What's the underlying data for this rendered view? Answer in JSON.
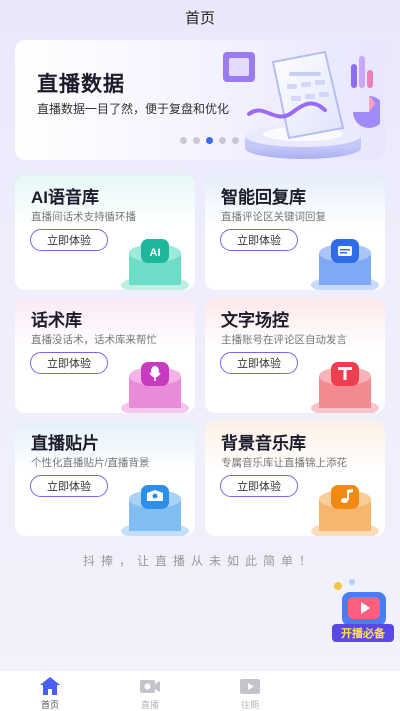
{
  "header": {
    "title": "首页"
  },
  "banner": {
    "title": "直播数据",
    "description": "直播数据一目了然，便于复盘和优化",
    "dots": 5,
    "active_dot": 2
  },
  "cards": [
    {
      "title": "AI语音库",
      "desc": "直播间话术支持循环播",
      "button": "立即体验",
      "icon": "ai-icon",
      "icon_text": "AI"
    },
    {
      "title": "智能回复库",
      "desc": "直播评论区关键词回复",
      "button": "立即体验",
      "icon": "reply-icon"
    },
    {
      "title": "话术库",
      "desc": "直播没话术，话术库来帮忙",
      "button": "立即体验",
      "icon": "microphone-icon"
    },
    {
      "title": "文字场控",
      "desc": "主播账号在评论区自动发言",
      "button": "立即体验",
      "icon": "text-t-icon"
    },
    {
      "title": "直播贴片",
      "desc": "个性化直播贴片/直播背景",
      "button": "立即体验",
      "icon": "sticker-icon"
    },
    {
      "title": "背景音乐库",
      "desc": "专属音乐库让直播锦上添花",
      "button": "立即体验",
      "icon": "music-note-icon"
    }
  ],
  "slogan": "抖捧，让直播从未如此简单！",
  "float_badge": {
    "label": "开播必备"
  },
  "tabbar": {
    "items": [
      {
        "label": "首页",
        "icon": "home-icon",
        "active": true
      },
      {
        "label": "直播",
        "icon": "camera-icon",
        "active": false
      },
      {
        "label": "往期",
        "icon": "video-icon",
        "active": false
      }
    ]
  },
  "colors": {
    "accent": "#3a6af0",
    "button_border": "#7a63e6"
  }
}
